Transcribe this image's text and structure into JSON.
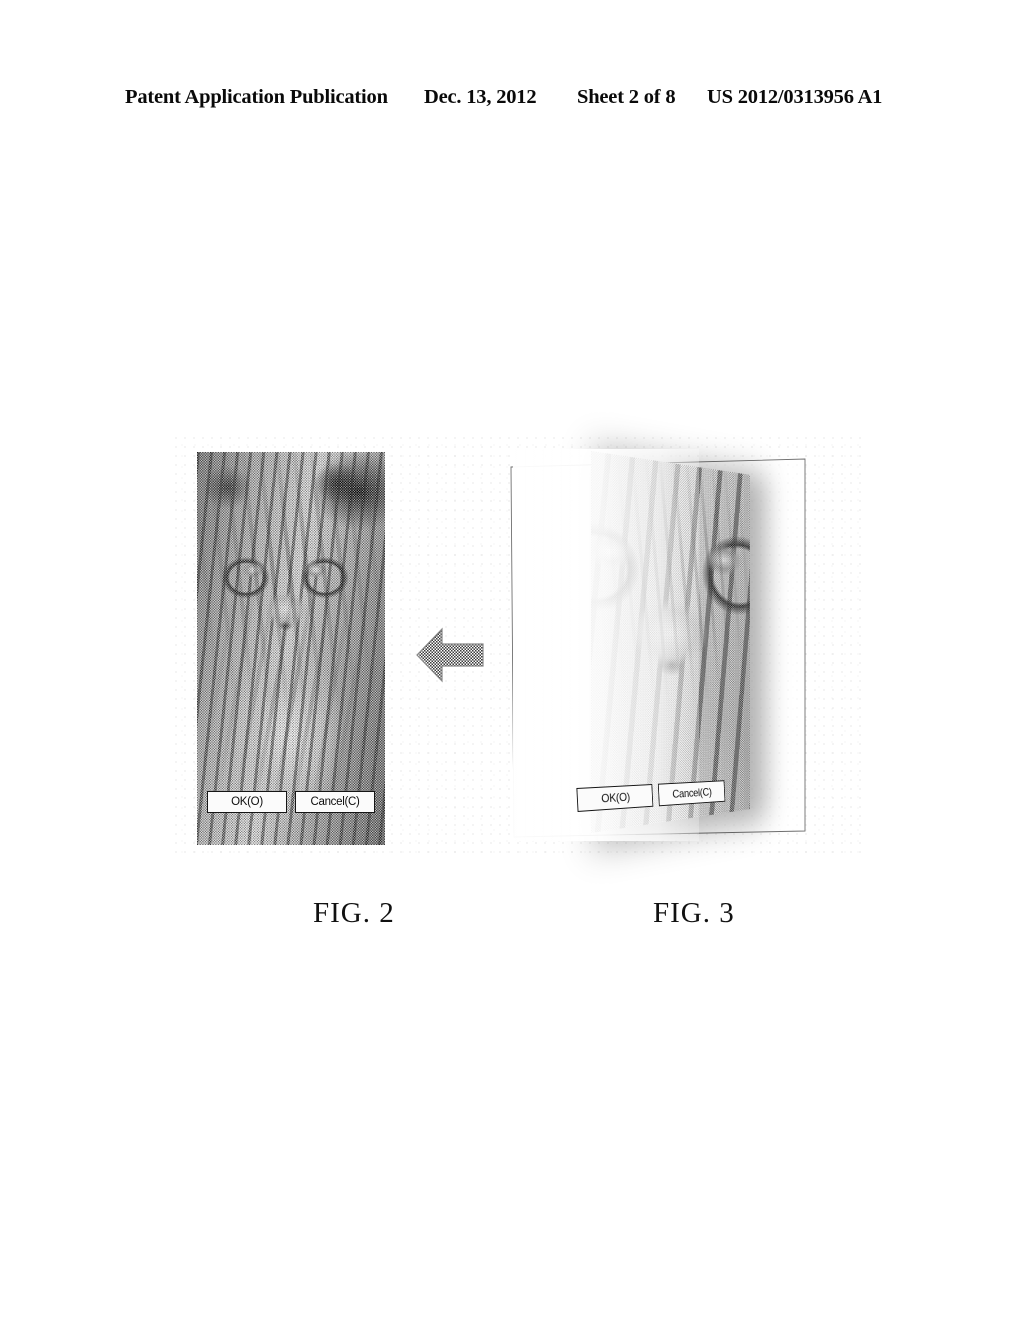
{
  "header": {
    "publication": "Patent Application Publication",
    "date": "Dec. 13, 2012",
    "sheet": "Sheet 2 of 8",
    "number": "US 2012/0313956 A1"
  },
  "figures": [
    {
      "id": "fig2",
      "caption": "FIG. 2",
      "description": "Flat two-dimensional dialog window containing a tiger photograph with two command buttons at the bottom",
      "image_subject": "tiger",
      "buttons": [
        {
          "label": "OK(O)"
        },
        {
          "label": "Cancel(C)"
        }
      ]
    },
    {
      "id": "fig3",
      "caption": "FIG. 3",
      "description": "The same dialog rendered in three-dimensional perspective, rotated about the vertical axis with a translucent page frame at the left",
      "image_subject": "tiger",
      "buttons": [
        {
          "label": "OK(O)"
        },
        {
          "label": "Cancel(C)"
        }
      ]
    }
  ],
  "arrow": {
    "name": "left-arrow",
    "direction": "left",
    "meaning": "transformation from FIG. 3 perspective view back to FIG. 2 flat view"
  },
  "colors": {
    "page_background": "#ffffff",
    "ink": "#000000",
    "button_face": "#fbfbfb",
    "arrow_fill": "#9a9a9a"
  }
}
